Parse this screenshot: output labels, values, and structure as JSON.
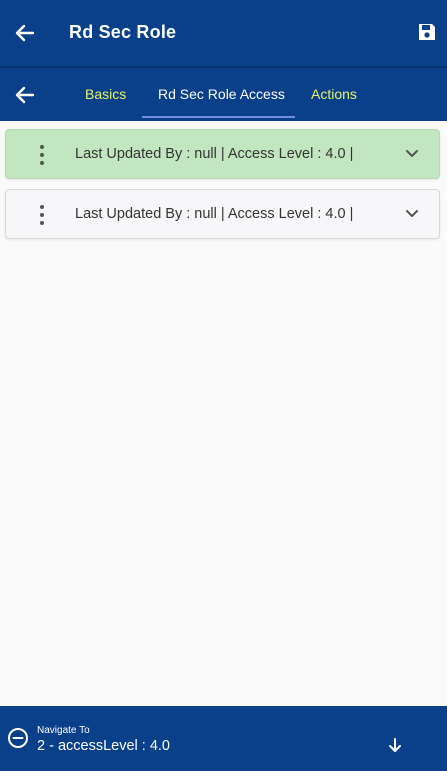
{
  "header": {
    "title": "Rd Sec Role",
    "back_icon": "arrow-left-icon",
    "save_icon": "save-icon"
  },
  "tabs": {
    "back_icon": "arrow-left-icon",
    "items": [
      {
        "label": "Basics"
      },
      {
        "label": "Rd Sec Role Access",
        "active": true
      },
      {
        "label": "Actions"
      }
    ]
  },
  "list": {
    "rows": [
      {
        "text": "Last Updated By  : null | Access Level  : 4.0 |",
        "selected": true
      },
      {
        "text": "Last Updated By  : null | Access Level  : 4.0 |",
        "selected": false
      }
    ]
  },
  "footer": {
    "label": "Navigate To",
    "value": "2 - accessLevel : 4.0"
  },
  "colors": {
    "primary": "#0a3f8a",
    "tab_accent": "#e6f56a",
    "selected_row": "#c2e6bf"
  }
}
